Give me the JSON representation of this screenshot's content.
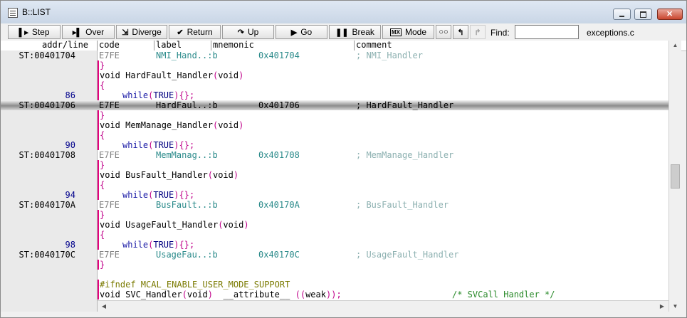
{
  "window": {
    "title": "B::LIST"
  },
  "toolbar": {
    "step": "Step",
    "over": "Over",
    "diverge": "Diverge",
    "return": "Return",
    "up": "Up",
    "go": "Go",
    "break": "Break",
    "mode": "Mode",
    "find_label": "Find:",
    "find_value": "",
    "file": "exceptions.c"
  },
  "columns": {
    "addr": "addr/line",
    "code": "code",
    "label": "label",
    "mnemonic": "mnemonic",
    "comment": "comment"
  },
  "rows": [
    {
      "type": "asm",
      "addr": "ST:00401704",
      "code": "E7FE",
      "label": "NMI_Hand..:b",
      "operand": "0x401704",
      "comment": "; NMI_Handler"
    },
    {
      "type": "brace",
      "text": "}"
    },
    {
      "type": "src",
      "text": "void HardFault_Handler(void)"
    },
    {
      "type": "brace",
      "text": "{"
    },
    {
      "type": "while",
      "line": "86",
      "text": "while(TRUE){};"
    },
    {
      "type": "asm",
      "selected": true,
      "addr": "ST:00401706",
      "code": "E7FE",
      "label": "HardFaul..:b",
      "operand": "0x401706",
      "comment": "; HardFault_Handler"
    },
    {
      "type": "brace",
      "text": "}"
    },
    {
      "type": "src",
      "text": "void MemManage_Handler(void)"
    },
    {
      "type": "brace",
      "text": "{"
    },
    {
      "type": "while",
      "line": "90",
      "text": "while(TRUE){};"
    },
    {
      "type": "asm",
      "addr": "ST:00401708",
      "code": "E7FE",
      "label": "MemManag..:b",
      "operand": "0x401708",
      "comment": "; MemManage_Handler"
    },
    {
      "type": "brace",
      "text": "}"
    },
    {
      "type": "src",
      "text": "void BusFault_Handler(void)"
    },
    {
      "type": "brace",
      "text": "{"
    },
    {
      "type": "while",
      "line": "94",
      "text": "while(TRUE){};"
    },
    {
      "type": "asm",
      "addr": "ST:0040170A",
      "code": "E7FE",
      "label": "BusFault..:b",
      "operand": "0x40170A",
      "comment": "; BusFault_Handler"
    },
    {
      "type": "brace",
      "text": "}"
    },
    {
      "type": "src",
      "text": "void UsageFault_Handler(void)"
    },
    {
      "type": "brace",
      "text": "{"
    },
    {
      "type": "while",
      "line": "98",
      "text": "while(TRUE){};"
    },
    {
      "type": "asm",
      "addr": "ST:0040170C",
      "code": "E7FE",
      "label": "UsageFau..:b",
      "operand": "0x40170C",
      "comment": "; UsageFault_Handler"
    },
    {
      "type": "brace",
      "text": "}"
    },
    {
      "type": "blank",
      "text": ""
    },
    {
      "type": "pre",
      "text": "#ifndef MCAL_ENABLE_USER_MODE_SUPPORT"
    },
    {
      "type": "svc",
      "text": "void SVC_Handler(void)  __attribute__ ((weak));",
      "comment": "/* SVCall Handler */"
    }
  ],
  "icons": {
    "step": "step-icon",
    "over": "step-over-icon",
    "diverge": "diverge-icon",
    "return": "return-icon",
    "up": "up-icon",
    "go": "go-icon",
    "break": "break-icon",
    "mode": "mode-icon",
    "glasses": "glasses-icon",
    "back": "back-icon",
    "forward": "forward-icon"
  }
}
